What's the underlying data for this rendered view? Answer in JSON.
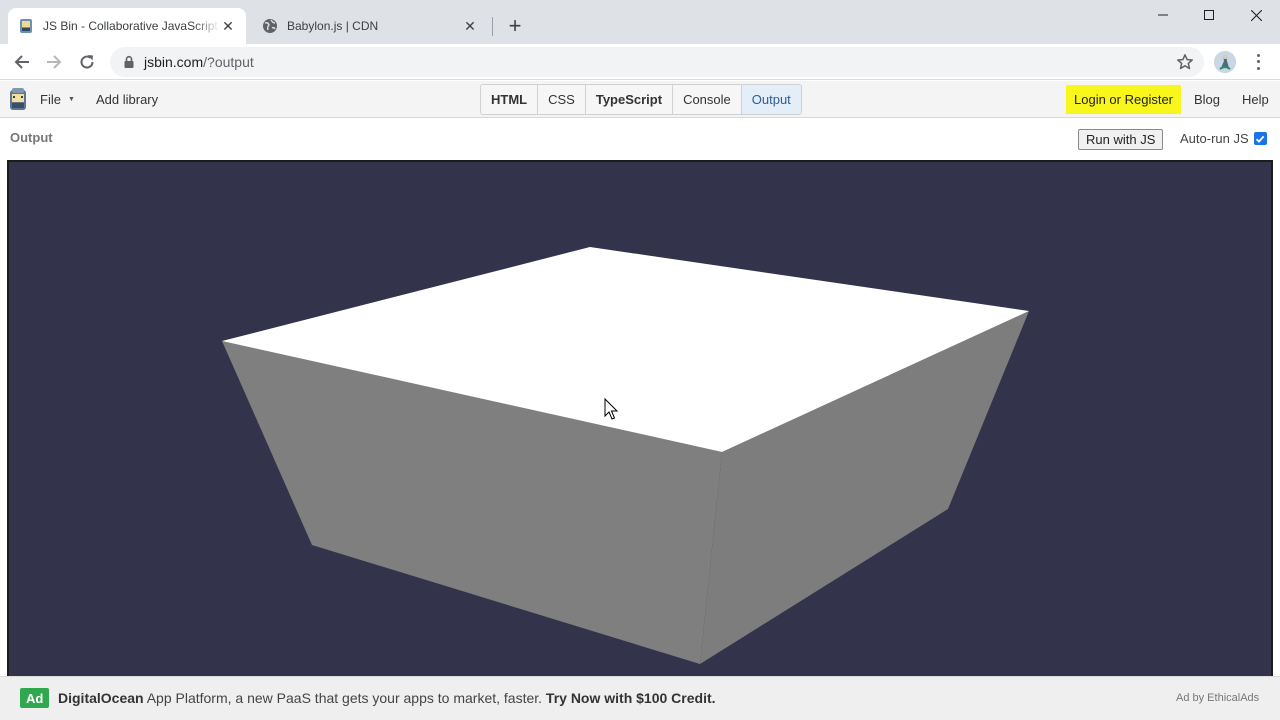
{
  "browser": {
    "tabs": [
      {
        "title": "JS Bin - Collaborative JavaScript Debugging",
        "favicon": "jsbin-icon",
        "active": true
      },
      {
        "title": "Babylon.js | CDN",
        "favicon": "globe-icon",
        "active": false
      }
    ],
    "url_host": "jsbin.com",
    "url_path": "/?output"
  },
  "jsbin": {
    "file_label": "File",
    "add_library_label": "Add library",
    "panels": [
      {
        "label": "HTML",
        "bold": true,
        "active": false
      },
      {
        "label": "CSS",
        "bold": false,
        "active": false
      },
      {
        "label": "TypeScript",
        "bold": true,
        "active": false
      },
      {
        "label": "Console",
        "bold": false,
        "active": false
      },
      {
        "label": "Output",
        "bold": false,
        "active": true
      }
    ],
    "login_label": "Login or Register",
    "blog_label": "Blog",
    "help_label": "Help"
  },
  "output": {
    "label": "Output",
    "run_button_label": "Run with JS",
    "autorun_label": "Auto-run JS",
    "autorun_checked": true
  },
  "scene": {
    "background_color": "#33334c",
    "top_face_color": "#ffffff",
    "front_face_color": "#7f7f7f",
    "side_face_color": "#7d7d7d"
  },
  "ad": {
    "badge": "Ad",
    "brand": "DigitalOcean",
    "text": " App Platform, a new PaaS that gets your apps to market, faster. ",
    "cta": "Try Now with $100 Credit.",
    "by": "Ad by EthicalAds"
  }
}
